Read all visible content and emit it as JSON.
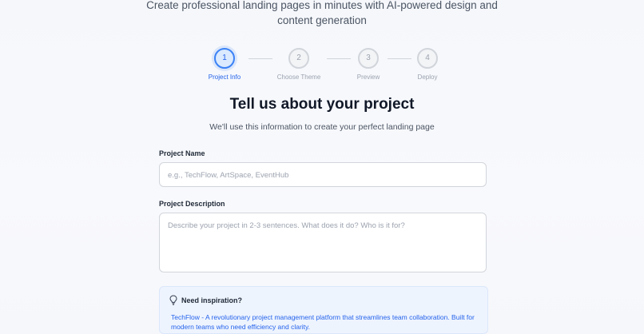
{
  "hero": {
    "subtitle_line1": "Create professional landing pages in minutes with AI-powered design and",
    "subtitle_line2": "content generation"
  },
  "stepper": {
    "active_step": 1,
    "steps": [
      {
        "number": "1",
        "label": "Project Info"
      },
      {
        "number": "2",
        "label": "Choose Theme"
      },
      {
        "number": "3",
        "label": "Preview"
      },
      {
        "number": "4",
        "label": "Deploy"
      }
    ]
  },
  "form": {
    "title": "Tell us about your project",
    "subtitle": "We'll use this information to create your perfect landing page",
    "project_name": {
      "label": "Project Name",
      "value": "",
      "placeholder": "e.g., TechFlow, ArtSpace, EventHub"
    },
    "project_description": {
      "label": "Project Description",
      "value": "",
      "placeholder": "Describe your project in 2-3 sentences. What does it do? Who is it for?"
    }
  },
  "inspiration": {
    "heading": "Need inspiration?",
    "icon": "lightbulb-icon",
    "example": "TechFlow - A revolutionary project management platform that streamlines team collaboration. Built for modern teams who need efficiency and clarity."
  },
  "colors": {
    "accent": "#3b82f6",
    "accent_text": "#2563eb",
    "inactive": "#9ca3af",
    "inspiration_bg": "#eef4fe"
  }
}
